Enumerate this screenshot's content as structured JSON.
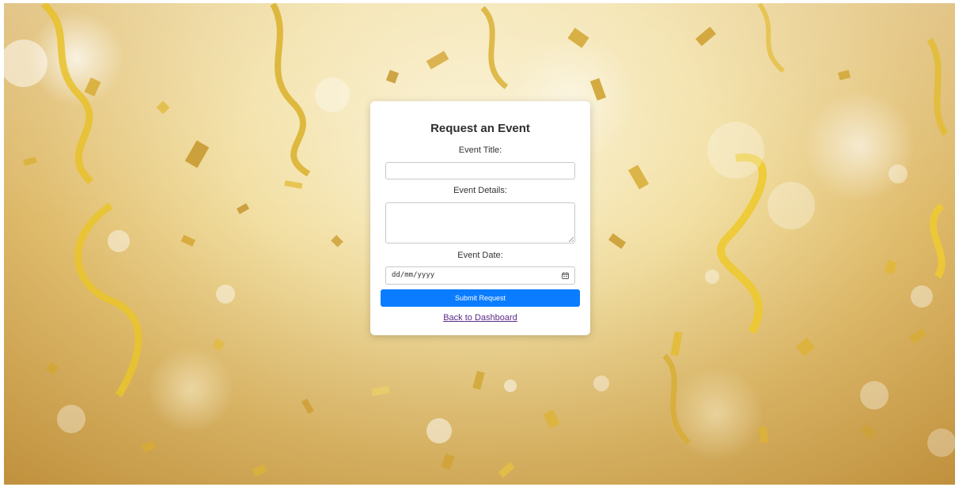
{
  "background": {
    "theme": "gold-confetti",
    "colors": {
      "light": "#fbf3d6",
      "mid": "#e0bd6e",
      "dark": "#c99a45",
      "ribbon": "#e7c12a"
    }
  },
  "form": {
    "title": "Request an Event",
    "event_title_label": "Event Title:",
    "event_title_value": "",
    "event_details_label": "Event Details:",
    "event_details_value": "",
    "event_date_label": "Event Date:",
    "event_date_placeholder": "dd/mm/yyyy",
    "calendar_icon": "calendar-icon",
    "submit_label": "Submit Request",
    "back_link_label": "Back to Dashboard",
    "accent_color": "#0a7cff",
    "link_color": "#5b2a86"
  }
}
